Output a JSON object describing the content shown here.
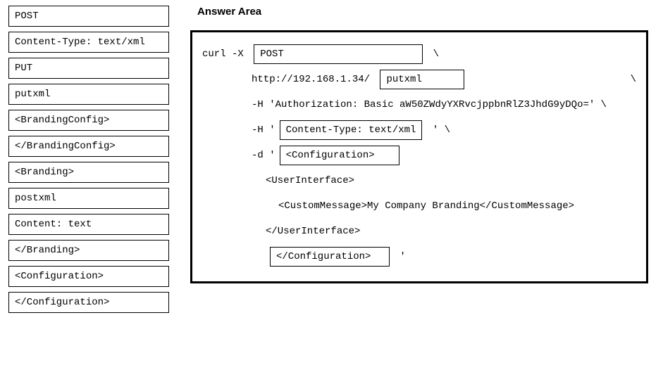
{
  "options": [
    "POST",
    "Content-Type: text/xml",
    "PUT",
    "putxml",
    "<BrandingConfig>",
    "</BrandingConfig>",
    "<Branding>",
    "postxml",
    "Content: text",
    "</Branding>",
    "<Configuration>",
    "</Configuration>"
  ],
  "answer": {
    "title": "Answer Area",
    "curl_prefix": "curl -X ",
    "slot_method": "POST",
    "backslash": " \\",
    "url_prefix": "http://192.168.1.34/ ",
    "slot_path": "putxml",
    "auth_line": "-H 'Authorization: Basic aW50ZWdyYXRvcjppbnRlZ3JhdG9yDQo=' \\",
    "h_prefix": "-H '",
    "slot_content_type": "Content-Type: text/xml",
    "h_suffix": " ' \\",
    "d_prefix": "-d '",
    "slot_open_tag": "<Configuration>",
    "user_interface_open": "<UserInterface>",
    "custom_message": "<CustomMessage>My Company Branding</CustomMessage>",
    "user_interface_close": "</UserInterface>",
    "slot_close_tag": "</Configuration>",
    "close_quote": " '"
  }
}
